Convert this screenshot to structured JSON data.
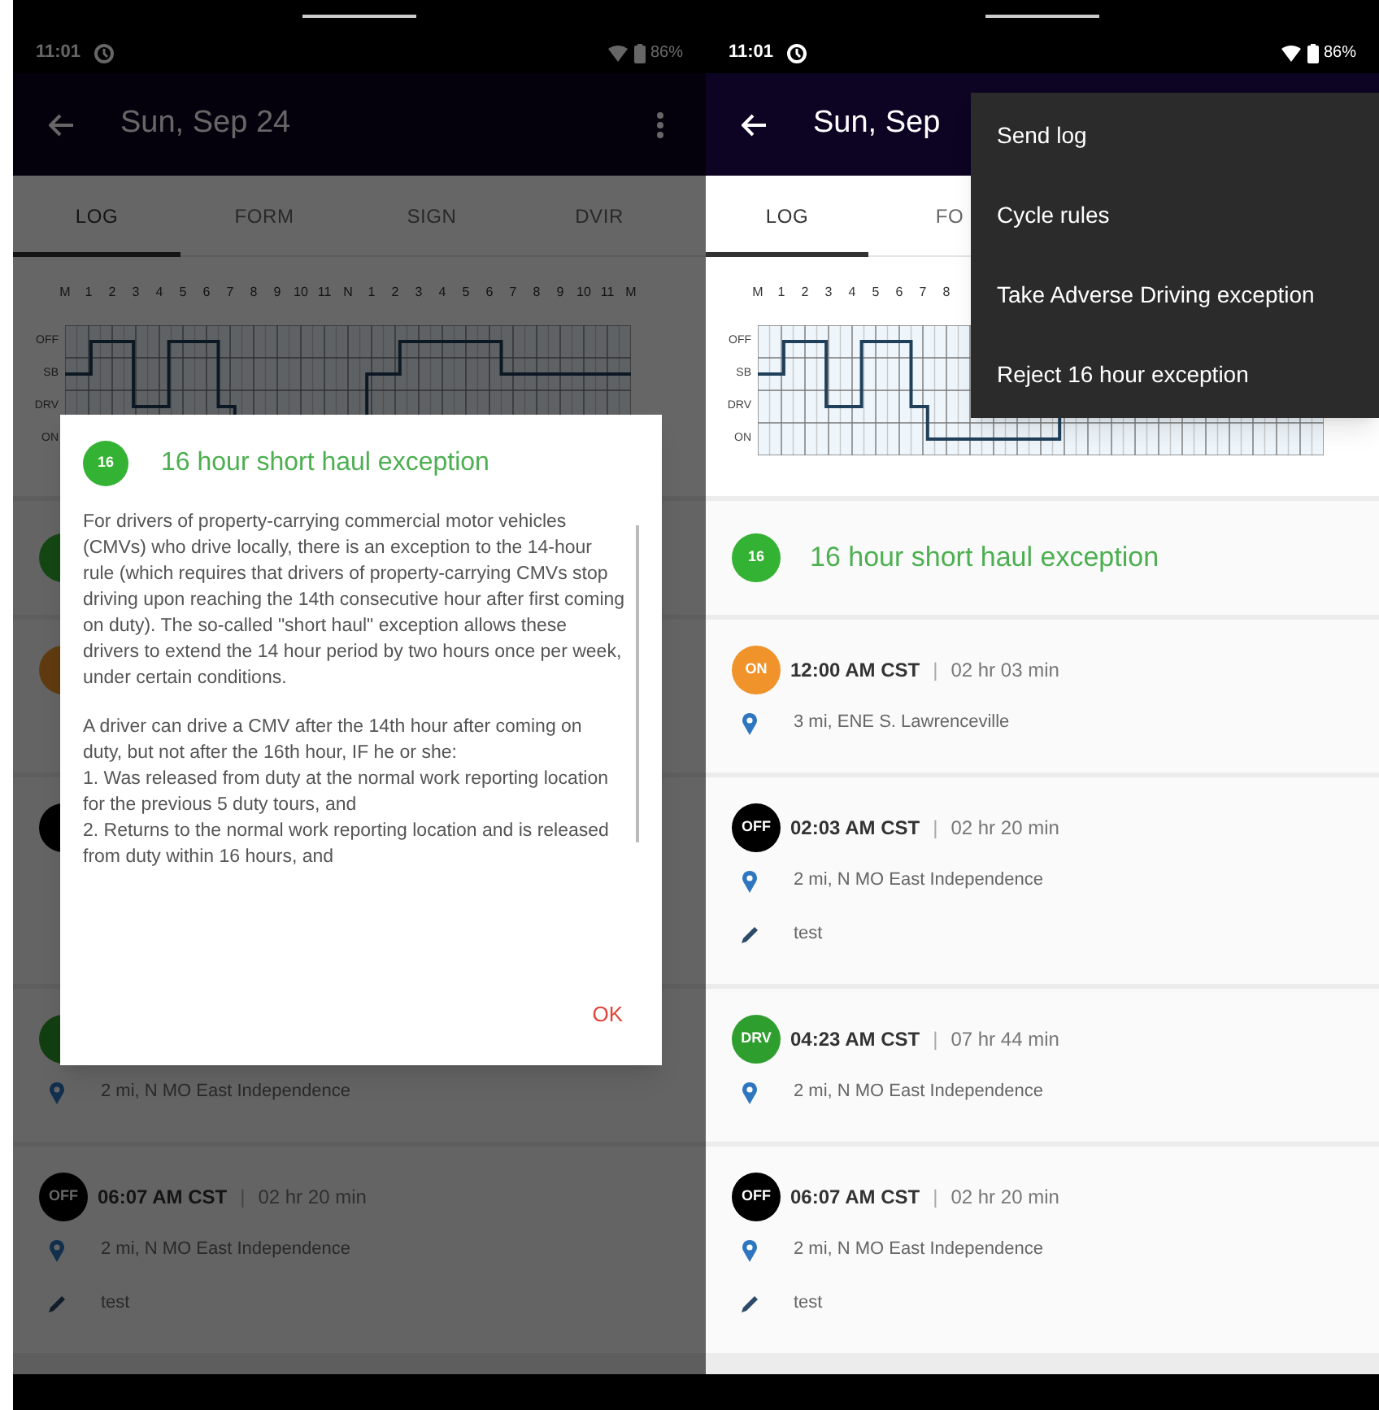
{
  "screens": [
    {
      "status_bar": {
        "time": "11:01",
        "battery": "86%"
      },
      "app_bar": {
        "title": "Sun, Sep 24",
        "overflow_icon": true
      },
      "tabs": [
        {
          "label": "LOG",
          "selected": true
        },
        {
          "label": "FORM",
          "selected": false
        },
        {
          "label": "SIGN",
          "selected": false
        },
        {
          "label": "DVIR",
          "selected": false
        }
      ],
      "graph": {
        "hours": [
          "M",
          "1",
          "2",
          "3",
          "4",
          "5",
          "6",
          "7",
          "8",
          "9",
          "10",
          "11",
          "N",
          "1",
          "2",
          "3",
          "4",
          "5",
          "6",
          "7",
          "8",
          "9",
          "10",
          "11",
          "M"
        ],
        "rows": [
          "OFF",
          "SB",
          "DRV",
          "ON"
        ]
      },
      "events": [
        {
          "kind": "exception"
        },
        {
          "kind": "on"
        },
        {
          "kind": "off",
          "note_line": true
        },
        {
          "kind": "drv",
          "location": "2 mi, N MO East Independence"
        },
        {
          "kind": "off",
          "badge": "OFF",
          "time": "06:07 AM CST",
          "separator": "|",
          "duration": "02 hr 20 min",
          "location": "2 mi, N MO East Independence",
          "note": "test"
        }
      ],
      "dialog": {
        "badge": "16",
        "title": "16 hour short haul exception",
        "paragraphs": [
          "For drivers of property-carrying commercial motor vehicles (CMVs) who drive locally, there is an exception to the 14-hour rule (which requires that drivers of property-carrying CMVs stop driving upon reaching the 14th consecutive hour after first coming on duty). The so-called \"short haul\" exception allows these drivers to extend the 14 hour period by two hours once per week, under certain conditions.",
          "A driver can drive a CMV after the 14th hour after coming on duty, but not after the 16th hour, IF he or she:\n1. Was released from duty at the normal work reporting location for the previous 5 duty tours, and\n2. Returns to the normal work reporting location and is released from duty within 16 hours, and"
        ],
        "button": "OK"
      }
    },
    {
      "status_bar": {
        "time": "11:01",
        "battery": "86%"
      },
      "app_bar": {
        "title": "Sun, Sep"
      },
      "tabs": [
        {
          "label": "LOG",
          "selected": true
        },
        {
          "label": "FO",
          "selected": false
        }
      ],
      "graph": {
        "hours": [
          "M",
          "1",
          "2",
          "3",
          "4",
          "5",
          "6",
          "7",
          "8"
        ],
        "rows": [
          "OFF",
          "SB",
          "DRV",
          "ON"
        ]
      },
      "events": [
        {
          "kind": "exception",
          "badge": "16",
          "title": "16 hour short haul exception"
        },
        {
          "kind": "on",
          "badge": "ON",
          "time": "12:00 AM CST",
          "separator": "|",
          "duration": "02 hr 03 min",
          "location": "3 mi, ENE S. Lawrenceville"
        },
        {
          "kind": "off",
          "badge": "OFF",
          "time": "02:03 AM CST",
          "separator": "|",
          "duration": "02 hr 20 min",
          "location": "2 mi, N MO East Independence",
          "note": "test"
        },
        {
          "kind": "drv",
          "badge": "DRV",
          "time": "04:23 AM CST",
          "separator": "|",
          "duration": "07 hr 44 min",
          "location": "2 mi, N MO East Independence"
        },
        {
          "kind": "off",
          "badge": "OFF",
          "time": "06:07 AM CST",
          "separator": "|",
          "duration": "02 hr 20 min",
          "location": "2 mi, N MO East Independence",
          "note": "test"
        }
      ],
      "menu": [
        "Send log",
        "Cycle rules",
        "Take Adverse Driving exception",
        "Reject 16 hour exception"
      ]
    }
  ]
}
